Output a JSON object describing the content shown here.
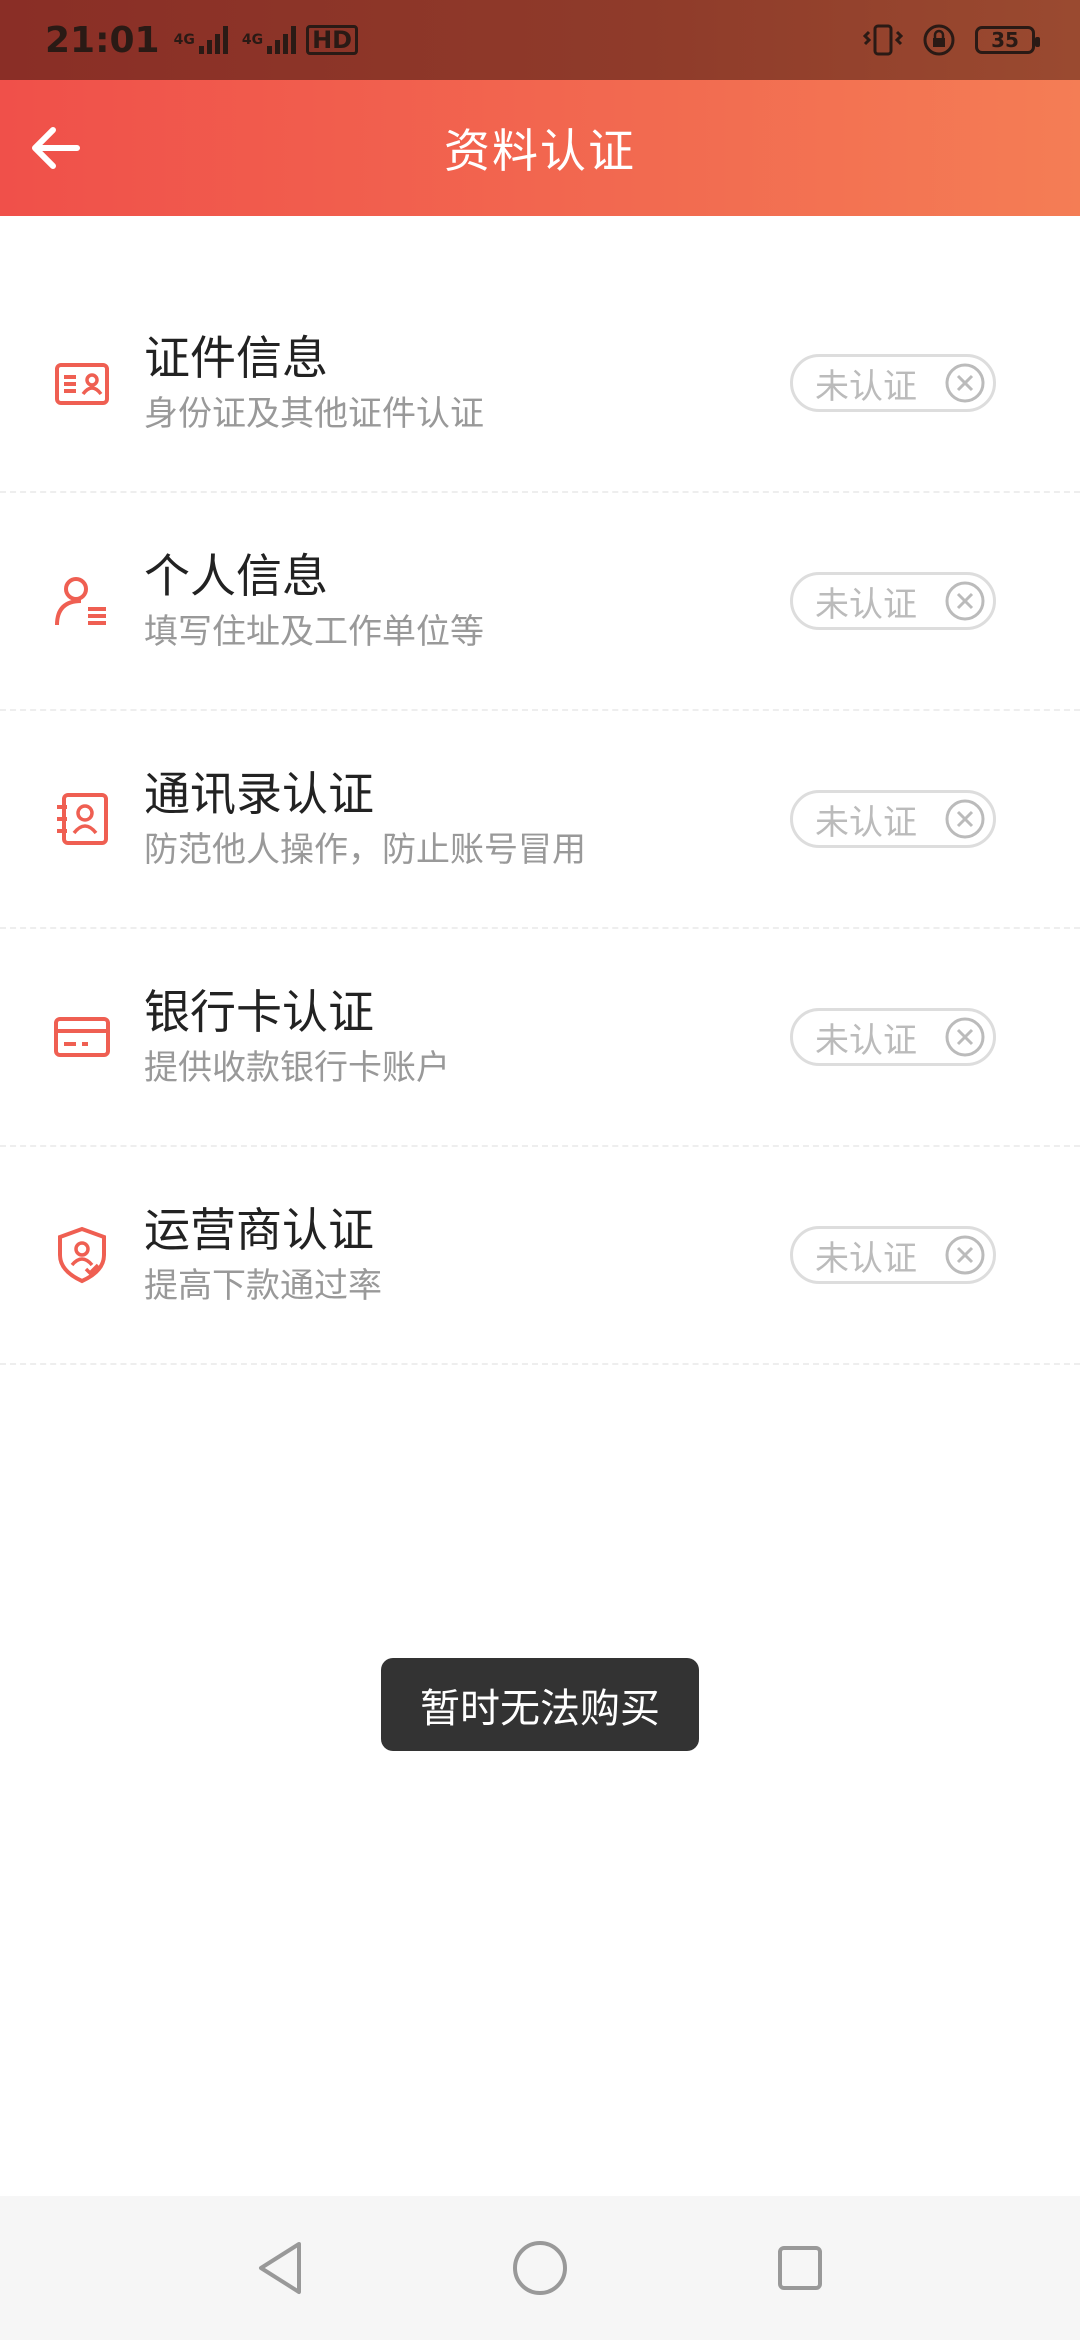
{
  "status_bar": {
    "time": "21:01",
    "sim1_label": "4G",
    "sim2_label": "4G",
    "hd_label": "HD",
    "battery": "35"
  },
  "app_bar": {
    "title": "资料认证",
    "back_icon": "arrow-left-icon"
  },
  "items": [
    {
      "title": "证件信息",
      "subtitle": "身份证及其他证件认证",
      "status": "未认证",
      "icon": "id-card-icon"
    },
    {
      "title": "个人信息",
      "subtitle": "填写住址及工作单位等",
      "status": "未认证",
      "icon": "person-info-icon"
    },
    {
      "title": "通讯录认证",
      "subtitle": "防范他人操作，防止账号冒用",
      "status": "未认证",
      "icon": "contacts-icon"
    },
    {
      "title": "银行卡认证",
      "subtitle": "提供收款银行卡账户",
      "status": "未认证",
      "icon": "bank-card-icon"
    },
    {
      "title": "运营商认证",
      "subtitle": "提高下款通过率",
      "status": "未认证",
      "icon": "shield-user-icon"
    }
  ],
  "toast": {
    "message": "暂时无法购买"
  },
  "colors": {
    "accent": "#f0504a",
    "accent_end": "#f47d55",
    "icon": "#ef5f52",
    "title_text": "#222222",
    "sub_text": "#999999",
    "pill_border": "#dddddd"
  }
}
